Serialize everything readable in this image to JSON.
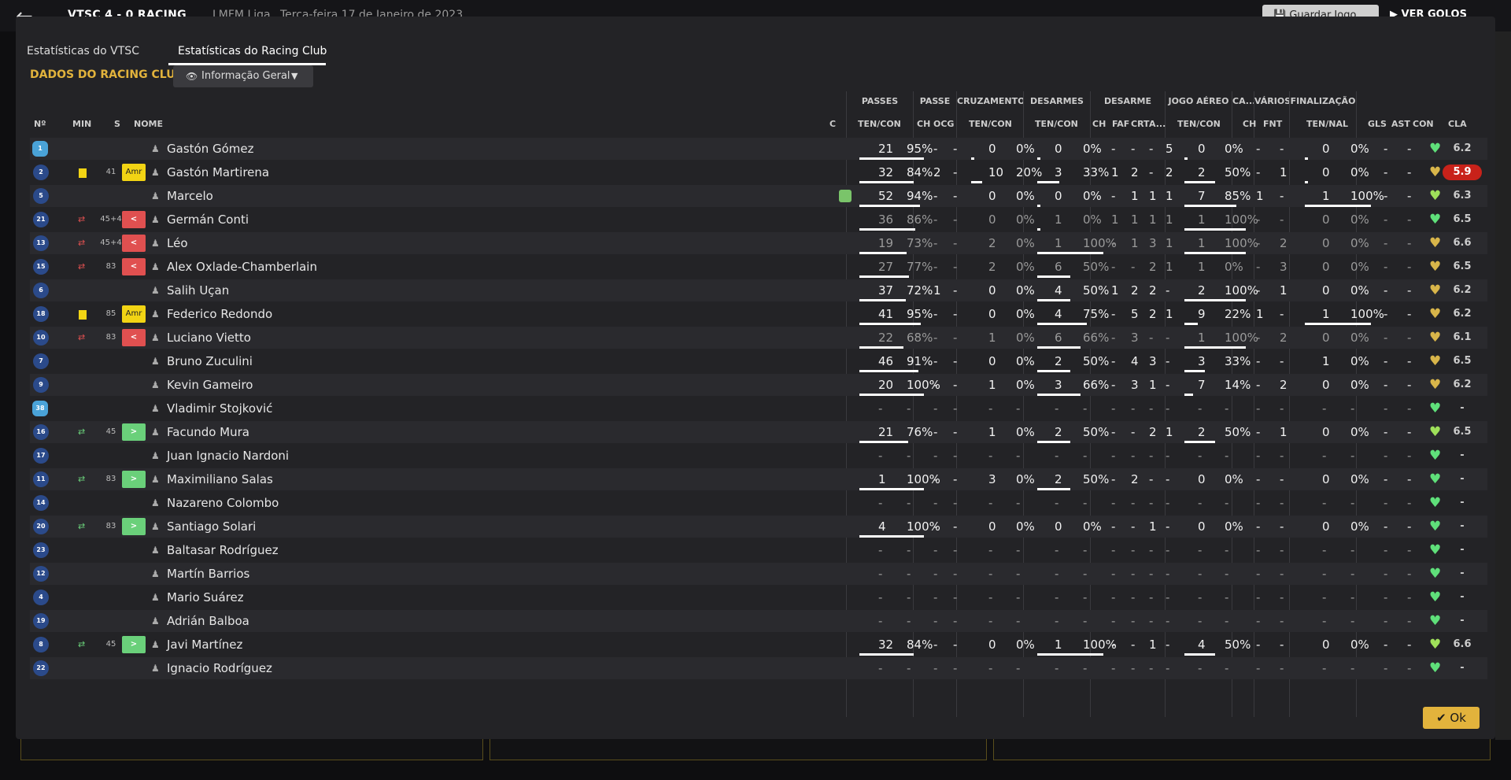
{
  "topbar": {
    "match": "VTSC 4 - 0 RACING",
    "competition": "LMFM Liga",
    "date": "Terça-feira 17 de Janeiro de 2023",
    "save": "Guardar Jogo",
    "goals": "VER GOLOS"
  },
  "tabs": [
    {
      "label": "Estatísticas do VTSC",
      "active": false
    },
    {
      "label": "Estatísticas do Racing Club",
      "active": true
    }
  ],
  "section_title": "DADOS DO RACING CLUB",
  "view_select": "Informação Geral",
  "group_headers": {
    "passes": "PASSES",
    "passe": "PASSE",
    "cruzamentos": "CRUZAMENTOS",
    "desarmes": "DESARMES",
    "desarme": "DESARME",
    "jogo_aereo": "JOGO AÉREO",
    "ca": "CA...",
    "varios": "VÁRIOS",
    "finalizacao": "FINALIZAÇÃO"
  },
  "columns": {
    "no": "Nº",
    "min": "MIN",
    "s": "S",
    "nome": "NOME",
    "c": "C",
    "pas": "TEN/CON",
    "ch": "CH",
    "ocg": "OCG",
    "cru": "TEN/CON",
    "des": "TEN/CON",
    "dch": "CH",
    "faf": "FAF",
    "crt": "CRT",
    "a": "A...",
    "aer": "TEN/CON",
    "cach": "CH",
    "fnt": "FNT",
    "fin": "TEN/NAL",
    "gls": "GLS",
    "ast": "AST",
    "con": "CON",
    "cla": "CLA"
  },
  "players": [
    {
      "no": "1",
      "gk": true,
      "name": "Gastón Gómez",
      "dim": false,
      "pas": [
        "21",
        "95%"
      ],
      "ps": [
        "-",
        "-"
      ],
      "cru": [
        "0",
        "0%"
      ],
      "des": [
        "0",
        "0%"
      ],
      "dd": [
        "-",
        "-",
        "-",
        "5"
      ],
      "aer": [
        "0",
        "0%"
      ],
      "cach": "-",
      "fnt": "-",
      "fin": [
        "0",
        "0%"
      ],
      "gls": "-",
      "ast": "-",
      "con": "g",
      "cla": "6.2"
    },
    {
      "no": "2",
      "card": "yellow",
      "min": "41",
      "badge": "Amr",
      "name": "Gastón Martirena",
      "dim": false,
      "pas": [
        "32",
        "84%"
      ],
      "ps": [
        "2",
        "-"
      ],
      "cru": [
        "10",
        "20%"
      ],
      "des": [
        "3",
        "33%"
      ],
      "dd": [
        "1",
        "2",
        "-",
        "2"
      ],
      "aer": [
        "2",
        "50%"
      ],
      "cach": "-",
      "fnt": "1",
      "fin": [
        "0",
        "0%"
      ],
      "gls": "-",
      "ast": "-",
      "con": "y",
      "cla": "5.9",
      "bad": true
    },
    {
      "no": "5",
      "name": "Marcelo",
      "dim": false,
      "cicon": true,
      "pas": [
        "52",
        "94%"
      ],
      "ps": [
        "-",
        "-"
      ],
      "cru": [
        "0",
        "0%"
      ],
      "des": [
        "0",
        "0%"
      ],
      "dd": [
        "-",
        "1",
        "1",
        "1"
      ],
      "aer": [
        "7",
        "85%"
      ],
      "cach": "1",
      "fnt": "-",
      "fin": [
        "1",
        "100%"
      ],
      "gls": "-",
      "ast": "-",
      "con": "lg",
      "cla": "6.3"
    },
    {
      "no": "21",
      "sub": "off",
      "min": "45+4",
      "badge": "<",
      "name": "Germán Conti",
      "dim": true,
      "pas": [
        "36",
        "86%"
      ],
      "ps": [
        "-",
        "-"
      ],
      "cru": [
        "0",
        "0%"
      ],
      "des": [
        "1",
        "0%"
      ],
      "dd": [
        "1",
        "1",
        "1",
        "1"
      ],
      "aer": [
        "1",
        "100%"
      ],
      "cach": "-",
      "fnt": "-",
      "fin": [
        "0",
        "0%"
      ],
      "gls": "-",
      "ast": "-",
      "con": "g",
      "cla": "6.5"
    },
    {
      "no": "13",
      "sub": "off",
      "min": "45+4",
      "badge": "<",
      "name": "Léo",
      "dim": true,
      "pas": [
        "19",
        "73%"
      ],
      "ps": [
        "-",
        "-"
      ],
      "cru": [
        "2",
        "0%"
      ],
      "des": [
        "1",
        "100%"
      ],
      "dd": [
        "-",
        "1",
        "3",
        "1"
      ],
      "aer": [
        "1",
        "100%"
      ],
      "cach": "-",
      "fnt": "2",
      "fin": [
        "0",
        "0%"
      ],
      "gls": "-",
      "ast": "-",
      "con": "y",
      "cla": "6.6"
    },
    {
      "no": "15",
      "sub": "off",
      "min": "83",
      "badge": "<",
      "name": "Alex Oxlade-Chamberlain",
      "dim": true,
      "pas": [
        "27",
        "77%"
      ],
      "ps": [
        "-",
        "-"
      ],
      "cru": [
        "2",
        "0%"
      ],
      "des": [
        "6",
        "50%"
      ],
      "dd": [
        "-",
        "-",
        "2",
        "1"
      ],
      "aer": [
        "1",
        "0%"
      ],
      "cach": "-",
      "fnt": "3",
      "fin": [
        "0",
        "0%"
      ],
      "gls": "-",
      "ast": "-",
      "con": "y",
      "cla": "6.5"
    },
    {
      "no": "6",
      "name": "Salih Uçan",
      "dim": false,
      "pas": [
        "37",
        "72%"
      ],
      "ps": [
        "1",
        "-"
      ],
      "cru": [
        "0",
        "0%"
      ],
      "des": [
        "4",
        "50%"
      ],
      "dd": [
        "1",
        "2",
        "2",
        "-"
      ],
      "aer": [
        "2",
        "100%"
      ],
      "cach": "-",
      "fnt": "1",
      "fin": [
        "0",
        "0%"
      ],
      "gls": "-",
      "ast": "-",
      "con": "y",
      "cla": "6.2"
    },
    {
      "no": "18",
      "card": "yellow",
      "min": "85",
      "badge": "Amr",
      "name": "Federico Redondo",
      "dim": false,
      "pas": [
        "41",
        "95%"
      ],
      "ps": [
        "-",
        "-"
      ],
      "cru": [
        "0",
        "0%"
      ],
      "des": [
        "4",
        "75%"
      ],
      "dd": [
        "-",
        "5",
        "2",
        "1"
      ],
      "aer": [
        "9",
        "22%"
      ],
      "cach": "1",
      "fnt": "-",
      "fin": [
        "1",
        "100%"
      ],
      "gls": "-",
      "ast": "-",
      "con": "y",
      "cla": "6.2"
    },
    {
      "no": "10",
      "sub": "off",
      "min": "83",
      "badge": "<",
      "name": "Luciano Vietto",
      "dim": true,
      "pas": [
        "22",
        "68%"
      ],
      "ps": [
        "-",
        "-"
      ],
      "cru": [
        "1",
        "0%"
      ],
      "des": [
        "6",
        "66%"
      ],
      "dd": [
        "-",
        "3",
        "-",
        "-"
      ],
      "aer": [
        "1",
        "100%"
      ],
      "cach": "-",
      "fnt": "2",
      "fin": [
        "0",
        "0%"
      ],
      "gls": "-",
      "ast": "-",
      "con": "y",
      "cla": "6.1"
    },
    {
      "no": "7",
      "name": "Bruno Zuculini",
      "dim": false,
      "pas": [
        "46",
        "91%"
      ],
      "ps": [
        "-",
        "-"
      ],
      "cru": [
        "0",
        "0%"
      ],
      "des": [
        "2",
        "50%"
      ],
      "dd": [
        "-",
        "4",
        "3",
        "-"
      ],
      "aer": [
        "3",
        "33%"
      ],
      "cach": "-",
      "fnt": "-",
      "fin": [
        "1",
        "0%"
      ],
      "gls": "-",
      "ast": "-",
      "con": "y",
      "cla": "6.5"
    },
    {
      "no": "9",
      "name": "Kevin Gameiro",
      "dim": false,
      "pas": [
        "20",
        "100%"
      ],
      "ps": [
        "-",
        "-"
      ],
      "cru": [
        "1",
        "0%"
      ],
      "des": [
        "3",
        "66%"
      ],
      "dd": [
        "-",
        "3",
        "1",
        "-"
      ],
      "aer": [
        "7",
        "14%"
      ],
      "cach": "-",
      "fnt": "2",
      "fin": [
        "0",
        "0%"
      ],
      "gls": "-",
      "ast": "-",
      "con": "y",
      "cla": "6.2"
    },
    {
      "no": "38",
      "gk": true,
      "name": "Vladimir Stojković",
      "dim": true,
      "empty": true,
      "con": "g",
      "cla": "-"
    },
    {
      "no": "16",
      "sub": "on",
      "min": "45",
      "badge": ">",
      "name": "Facundo Mura",
      "dim": false,
      "pas": [
        "21",
        "76%"
      ],
      "ps": [
        "-",
        "-"
      ],
      "cru": [
        "1",
        "0%"
      ],
      "des": [
        "2",
        "50%"
      ],
      "dd": [
        "-",
        "-",
        "2",
        "1"
      ],
      "aer": [
        "2",
        "50%"
      ],
      "cach": "-",
      "fnt": "1",
      "fin": [
        "0",
        "0%"
      ],
      "gls": "-",
      "ast": "-",
      "con": "lg",
      "cla": "6.5"
    },
    {
      "no": "17",
      "name": "Juan Ignacio Nardoni",
      "dim": true,
      "empty": true,
      "con": "g",
      "cla": "-"
    },
    {
      "no": "11",
      "sub": "on",
      "min": "83",
      "badge": ">",
      "name": "Maximiliano Salas",
      "dim": false,
      "pas": [
        "1",
        "100%"
      ],
      "ps": [
        "-",
        "-"
      ],
      "cru": [
        "3",
        "0%"
      ],
      "des": [
        "2",
        "50%"
      ],
      "dd": [
        "-",
        "2",
        "-",
        "-"
      ],
      "aer": [
        "0",
        "0%"
      ],
      "cach": "-",
      "fnt": "-",
      "fin": [
        "0",
        "0%"
      ],
      "gls": "-",
      "ast": "-",
      "con": "g",
      "cla": "-"
    },
    {
      "no": "14",
      "name": "Nazareno Colombo",
      "dim": true,
      "empty": true,
      "con": "g",
      "cla": "-"
    },
    {
      "no": "20",
      "sub": "on",
      "min": "83",
      "badge": ">",
      "name": "Santiago Solari",
      "dim": false,
      "pas": [
        "4",
        "100%"
      ],
      "ps": [
        "-",
        "-"
      ],
      "cru": [
        "0",
        "0%"
      ],
      "des": [
        "0",
        "0%"
      ],
      "dd": [
        "-",
        "-",
        "1",
        "-"
      ],
      "aer": [
        "0",
        "0%"
      ],
      "cach": "-",
      "fnt": "-",
      "fin": [
        "0",
        "0%"
      ],
      "gls": "-",
      "ast": "-",
      "con": "g",
      "cla": "-"
    },
    {
      "no": "23",
      "name": "Baltasar Rodríguez",
      "dim": true,
      "empty": true,
      "con": "g",
      "cla": "-"
    },
    {
      "no": "12",
      "name": "Martín Barrios",
      "dim": true,
      "empty": true,
      "con": "g",
      "cla": "-"
    },
    {
      "no": "4",
      "name": "Mario Suárez",
      "dim": true,
      "empty": true,
      "con": "g",
      "cla": "-"
    },
    {
      "no": "19",
      "name": "Adrián Balboa",
      "dim": true,
      "empty": true,
      "con": "g",
      "cla": "-"
    },
    {
      "no": "8",
      "sub": "on",
      "min": "45",
      "badge": ">",
      "name": "Javi Martínez",
      "dim": false,
      "pas": [
        "32",
        "84%"
      ],
      "ps": [
        "-",
        "-"
      ],
      "cru": [
        "0",
        "0%"
      ],
      "des": [
        "1",
        "100%"
      ],
      "dd": [
        "-",
        "-",
        "1",
        "-"
      ],
      "aer": [
        "4",
        "50%"
      ],
      "cach": "-",
      "fnt": "-",
      "fin": [
        "0",
        "0%"
      ],
      "gls": "-",
      "ast": "-",
      "con": "lg",
      "cla": "6.6"
    },
    {
      "no": "22",
      "name": "Ignacio Rodríguez",
      "dim": true,
      "empty": true,
      "con": "g",
      "cla": "-"
    }
  ],
  "ok_label": "Ok",
  "colors": {
    "accent": "#e2b33c",
    "bad_rating": "#c8221a",
    "yellow_card": "#f2d414",
    "sub_in": "#6ad07a",
    "sub_out": "#e05050"
  }
}
